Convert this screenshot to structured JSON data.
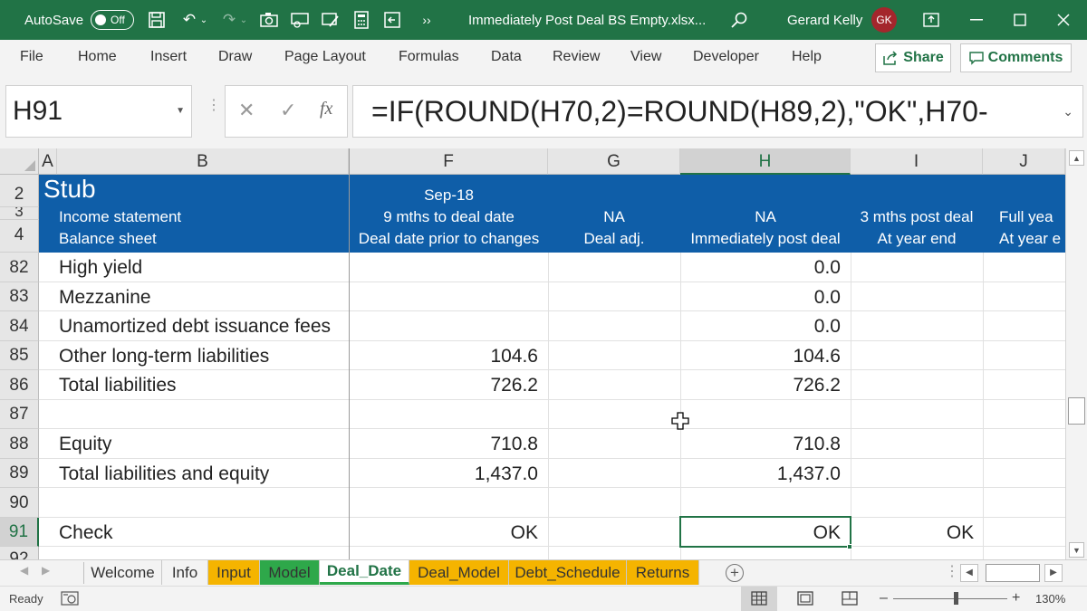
{
  "title_bar": {
    "autosave_label": "AutoSave",
    "autosave_state": "Off",
    "more_glyph": "››",
    "filename": "Immediately Post Deal BS Empty.xlsx...",
    "user_name": "Gerard Kelly",
    "user_initials": "GK"
  },
  "ribbon": {
    "tabs": [
      "File",
      "Home",
      "Insert",
      "Draw",
      "Page Layout",
      "Formulas",
      "Data",
      "Review",
      "View",
      "Developer",
      "Help"
    ],
    "share_label": "Share",
    "comments_label": "Comments"
  },
  "formula_bar": {
    "name_box": "H91",
    "fx_label": "fx",
    "formula": "=IF(ROUND(H70,2)=ROUND(H89,2),\"OK\",H70-"
  },
  "columns": [
    "A",
    "B",
    "F",
    "G",
    "H",
    "I",
    "J"
  ],
  "selected_column": "H",
  "header": {
    "rows": [
      "2",
      "3",
      "4"
    ],
    "stub": "Stub",
    "income_statement": "Income statement",
    "balance_sheet": "Balance sheet",
    "F_line1": "Sep-18",
    "F_line2": "9 mths to deal date",
    "F_line3": "Deal date prior to changes",
    "G_line2": "NA",
    "G_line3": "Deal adj.",
    "H_line2": "NA",
    "H_line3": "Immediately post deal",
    "I_line2": "3 mths post deal",
    "I_line3": "At year end",
    "J_line2": "Full yea",
    "J_line3": "At year e"
  },
  "rows": [
    {
      "num": "82",
      "label": "High yield",
      "F": "",
      "H": "0.0",
      "I": ""
    },
    {
      "num": "83",
      "label": "Mezzanine",
      "F": "",
      "H": "0.0",
      "I": ""
    },
    {
      "num": "84",
      "label": "Unamortized debt issuance fees",
      "F": "",
      "H": "0.0",
      "I": ""
    },
    {
      "num": "85",
      "label": "Other long-term liabilities",
      "F": "104.6",
      "H": "104.6",
      "I": ""
    },
    {
      "num": "86",
      "label": "Total liabilities",
      "F": "726.2",
      "H": "726.2",
      "I": ""
    },
    {
      "num": "87",
      "label": "",
      "F": "",
      "H": "",
      "I": ""
    },
    {
      "num": "88",
      "label": "Equity",
      "F": "710.8",
      "H": "710.8",
      "I": ""
    },
    {
      "num": "89",
      "label": "Total liabilities and equity",
      "F": "1,437.0",
      "H": "1,437.0",
      "I": ""
    },
    {
      "num": "90",
      "label": "",
      "F": "",
      "H": "",
      "I": ""
    },
    {
      "num": "91",
      "label": "Check",
      "F": "OK",
      "H": "OK",
      "I": "OK"
    }
  ],
  "sheet_tabs": [
    {
      "label": "Welcome",
      "color": "#f3f3f3"
    },
    {
      "label": "Info",
      "color": "#f3f3f3"
    },
    {
      "label": "Input",
      "color": "#f5b400"
    },
    {
      "label": "Model",
      "color": "#2ea84a"
    },
    {
      "label": "Deal_Date",
      "color": "#ffffff"
    },
    {
      "label": "Deal_Model",
      "color": "#f5b400"
    },
    {
      "label": "Debt_Schedule",
      "color": "#f5b400"
    },
    {
      "label": "Returns",
      "color": "#f5b400"
    }
  ],
  "active_sheet": "Deal_Date",
  "status_bar": {
    "ready": "Ready",
    "zoom": "130%",
    "zoom_minus": "–",
    "zoom_plus": "+"
  },
  "colors": {
    "excel_green": "#217346",
    "header_blue": "#0f5ea8"
  }
}
